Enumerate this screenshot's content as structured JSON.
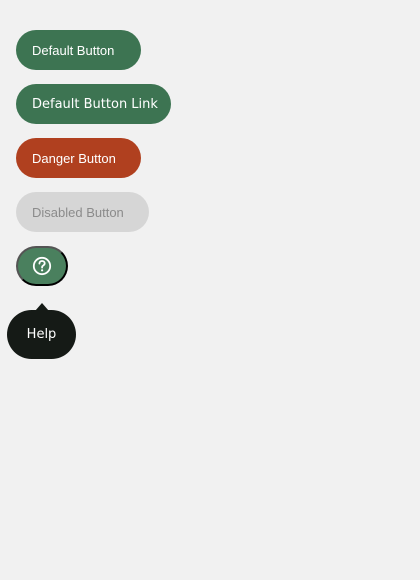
{
  "colors": {
    "background": "#f1f1f1",
    "primary": "#3d7452",
    "primary_light": "#4a805e",
    "danger": "#b0401f",
    "disabled_bg": "#d6d6d6",
    "disabled_text": "#8b8b8b",
    "on_color_text": "#ffffff",
    "tooltip_bg": "#151a16"
  },
  "buttons": {
    "default_label": "Default Button",
    "link_label": "Default Button Link",
    "danger_label": "Danger Button",
    "disabled_label": "Disabled Button"
  },
  "icon_button": {
    "icon": "help-circle-icon"
  },
  "tooltip": {
    "text": "Help"
  }
}
